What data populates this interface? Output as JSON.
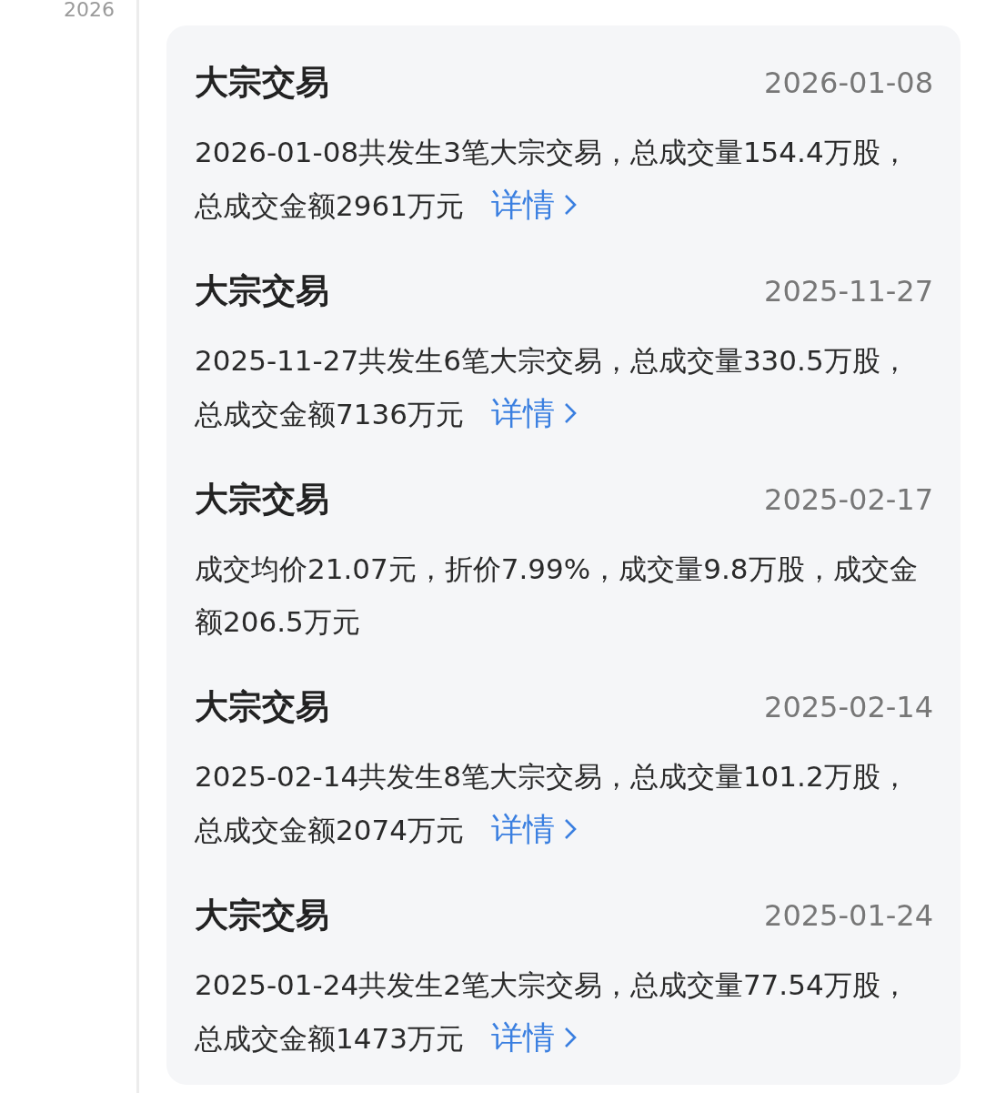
{
  "timeline": {
    "year_label": "2026"
  },
  "events": [
    {
      "title": "大宗交易",
      "date": "2026-01-08",
      "text": "2026-01-08共发生3笔大宗交易，总成交量154.4万股，总成交金额2961万元",
      "link": "详情"
    },
    {
      "title": "大宗交易",
      "date": "2025-11-27",
      "text": "2025-11-27共发生6笔大宗交易，总成交量330.5万股，总成交金额7136万元",
      "link": "详情"
    },
    {
      "title": "大宗交易",
      "date": "2025-02-17",
      "text": "成交均价21.07元，折价7.99%，成交量9.8万股，成交金额206.5万元"
    },
    {
      "title": "大宗交易",
      "date": "2025-02-14",
      "text": "2025-02-14共发生8笔大宗交易，总成交量101.2万股，总成交金额2074万元",
      "link": "详情"
    },
    {
      "title": "大宗交易",
      "date": "2025-01-24",
      "text": "2025-01-24共发生2笔大宗交易，总成交量77.54万股，总成交金额1473万元",
      "link": "详情"
    }
  ]
}
